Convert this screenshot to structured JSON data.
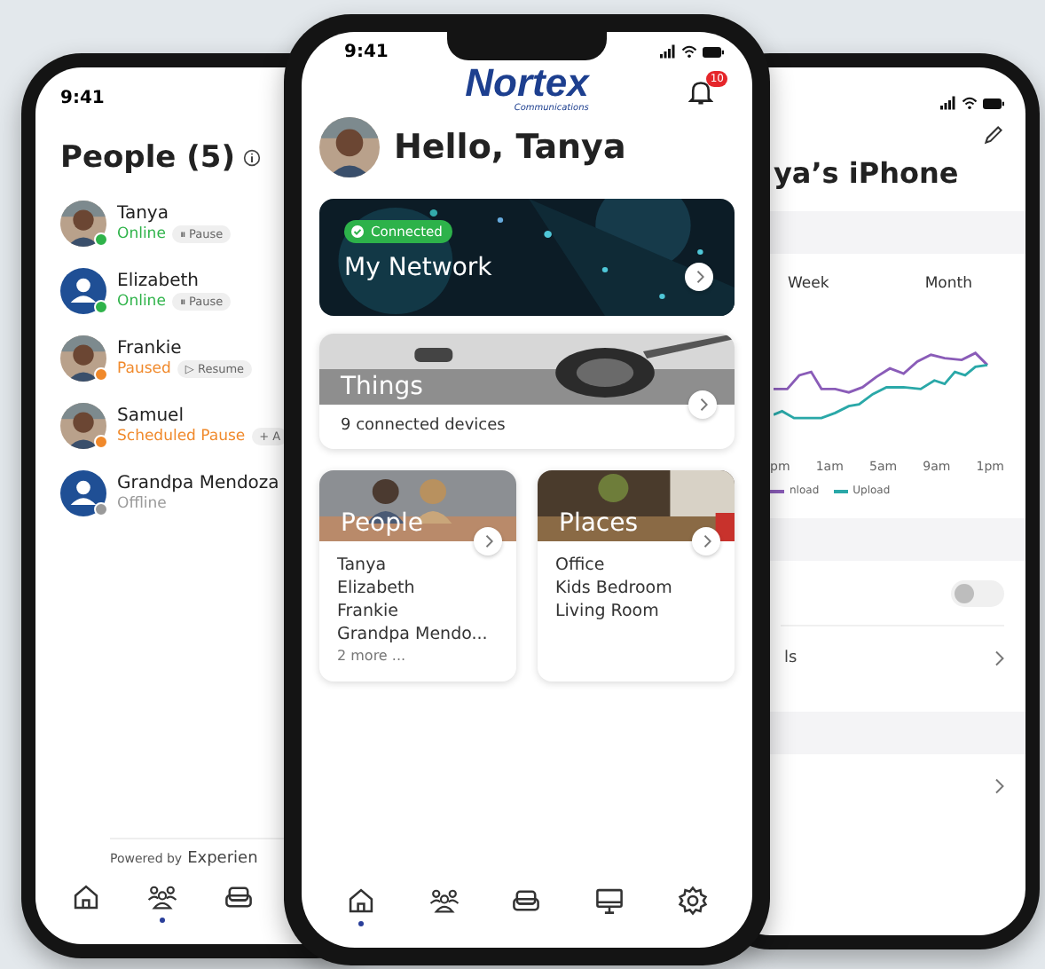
{
  "left_phone": {
    "time": "9:41",
    "title": "People (5)",
    "people": [
      {
        "name": "Tanya",
        "status": "Online",
        "color": "#2fb34a",
        "action": "⏸ Pause"
      },
      {
        "name": "Elizabeth",
        "status": "Online",
        "color": "#2fb34a",
        "kind": "generic",
        "action": "⏸ Pause"
      },
      {
        "name": "Frankie",
        "status": "Paused",
        "color": "#f0892b",
        "action": "▷ Resume"
      },
      {
        "name": "Samuel",
        "status": "Scheduled Pause",
        "color": "#f0892b",
        "action": "+ A"
      },
      {
        "name": "Grandpa Mendoza",
        "status": "Offline",
        "color": "#9a9a9a",
        "kind": "generic"
      }
    ],
    "powered_by": "Powered by",
    "brand": "Experien",
    "nav": [
      {
        "kind": "home",
        "selected": false
      },
      {
        "kind": "people",
        "selected": true
      },
      {
        "kind": "sofa",
        "selected": false
      }
    ]
  },
  "center_phone": {
    "time": "9:41",
    "logo": {
      "name": "Nortex",
      "tagline": "Communications"
    },
    "notifications": "10",
    "greeting": "Hello, Tanya",
    "network": {
      "badge": "Connected",
      "title": "My Network"
    },
    "things": {
      "title": "Things",
      "subtitle": "9 connected devices"
    },
    "people_card": {
      "title": "People",
      "items": [
        "Tanya",
        "Elizabeth",
        "Frankie",
        "Grandpa Mendo..."
      ],
      "more": "2 more ..."
    },
    "places_card": {
      "title": "Places",
      "items": [
        "Office",
        "Kids Bedroom",
        "Living Room"
      ]
    },
    "nav": [
      {
        "kind": "home",
        "selected": true
      },
      {
        "kind": "people",
        "selected": false
      },
      {
        "kind": "sofa",
        "selected": false
      },
      {
        "kind": "monitor",
        "selected": false
      },
      {
        "kind": "gear",
        "selected": false
      }
    ]
  },
  "right_phone": {
    "title": "ya’s iPhone",
    "tabs": [
      {
        "label": "Week",
        "selected": false
      },
      {
        "label": "Month",
        "selected": false
      }
    ],
    "x_labels": [
      "pm",
      "1am",
      "5am",
      "9am",
      "1pm"
    ],
    "legend": [
      {
        "label": "nload",
        "color": "#8a5cb8"
      },
      {
        "label": "Upload",
        "color": "#2aa8a8"
      }
    ],
    "toggle": {
      "on": false
    },
    "row_label": "ls"
  }
}
